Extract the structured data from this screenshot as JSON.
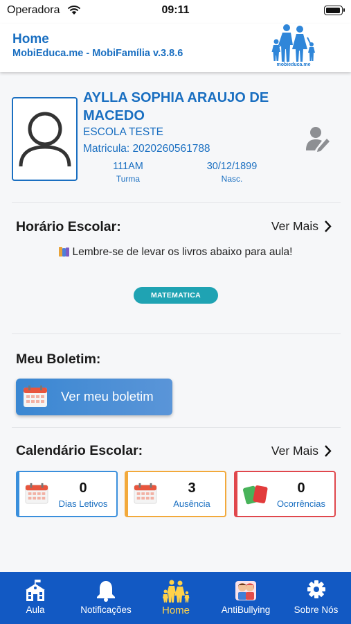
{
  "status_bar": {
    "carrier": "Operadora",
    "time": "09:11"
  },
  "header": {
    "title": "Home",
    "subtitle": "MobiEduca.me - MobiFamília v.3.8.6",
    "logo_text": "mobieduca.me",
    "brand_color": "#1a6fc1"
  },
  "student": {
    "name": "AYLLA SOPHIA ARAUJO DE MACEDO",
    "school": "ESCOLA TESTE",
    "matricula": "Matricula: 2020260561788",
    "class_value": "111AM",
    "class_label": "Turma",
    "birth_value": "30/12/1899",
    "birth_label": "Nasc."
  },
  "schedule": {
    "title": "Horário Escolar:",
    "see_more": "Ver Mais",
    "reminder": "Lembre-se de levar os livros abaixo para aula!",
    "subjects": [
      "MATEMATICA"
    ],
    "chip_color": "#1fa3b3"
  },
  "report": {
    "title": "Meu Boletim:",
    "button_label": "Ver meu boletim"
  },
  "calendar": {
    "title": "Calendário Escolar:",
    "see_more": "Ver Mais",
    "cards": [
      {
        "value": "0",
        "label": "Dias Letivos",
        "color": "#3a8fdc",
        "icon": "calendar-icon"
      },
      {
        "value": "3",
        "label": "Ausência",
        "color": "#f2a93b",
        "icon": "calendar-icon"
      },
      {
        "value": "0",
        "label": "Ocorrências",
        "color": "#e0474c",
        "icon": "cards-icon"
      }
    ]
  },
  "bottom_nav": {
    "background": "#1259c3",
    "active_color": "#ffd24a",
    "items": [
      {
        "label": "Aula",
        "icon": "school-icon"
      },
      {
        "label": "Notificações",
        "icon": "bell-icon"
      },
      {
        "label": "Home",
        "icon": "family-icon",
        "active": true
      },
      {
        "label": "AntiBullying",
        "icon": "kids-icon"
      },
      {
        "label": "Sobre Nós",
        "icon": "gear-icon"
      }
    ]
  }
}
